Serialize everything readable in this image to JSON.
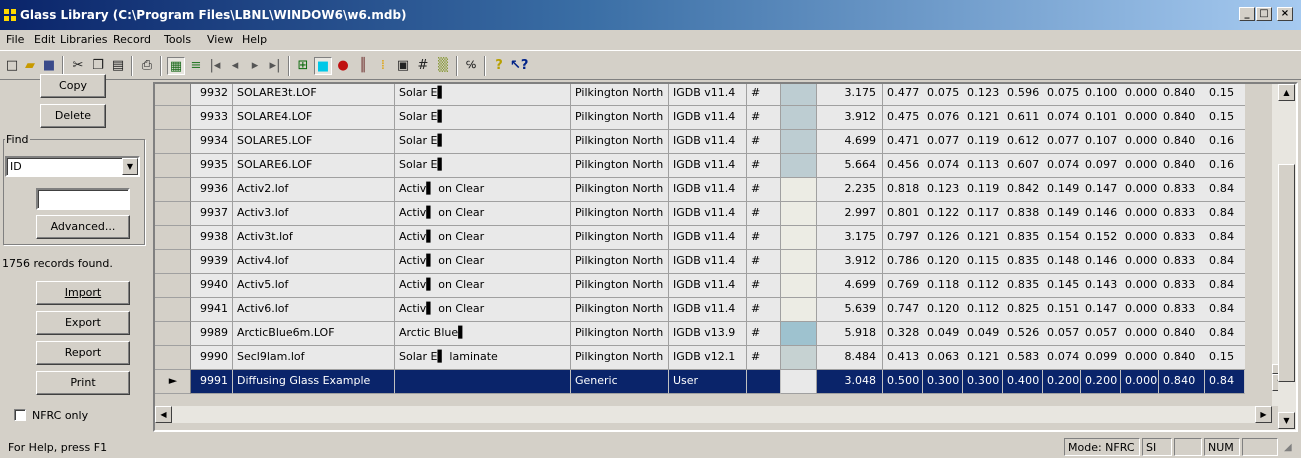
{
  "window": {
    "title": "Glass Library (C:\\Program Files\\LBNL\\WINDOW6\\w6.mdb)",
    "controls": {
      "minimize": "_",
      "maximize": "□",
      "close": "×"
    }
  },
  "menu": [
    "File",
    "Edit",
    "Libraries",
    "Record",
    "Tools",
    "View",
    "Help"
  ],
  "toolbar_icons": [
    "new-icon",
    "open-icon",
    "save-icon",
    "cut-icon",
    "copy-icon",
    "paste-icon",
    "print-icon",
    "grid-view-icon",
    "list-view-icon",
    "first-record-icon",
    "prev-record-icon",
    "next-record-icon",
    "last-record-icon",
    "layout-icon",
    "color-icon",
    "pin-icon",
    "bars-icon",
    "spectrum-icon",
    "square-icon",
    "hash-icon",
    "gradient-icon",
    "units-icon",
    "help-icon",
    "context-help-icon"
  ],
  "left": {
    "copy_label": "Copy",
    "delete_label": "Delete",
    "find_label": "Find",
    "find_field": "ID",
    "find_text": "",
    "advanced_label": "Advanced...",
    "records_found": "1756 records found.",
    "import_label": "Import",
    "export_label": "Export",
    "report_label": "Report",
    "print_label": "Print",
    "nfrc_label": "NFRC only"
  },
  "rows": [
    {
      "id": "9932",
      "name": "SOLARE3t.LOF",
      "product": "Solar E▌",
      "mfr": "Pilkington North",
      "source": "IGDB v11.4",
      "flag": "#",
      "color": "#bdcdd2",
      "thick": "3.175",
      "v": [
        "0.477",
        "0.075",
        "0.123",
        "0.596",
        "0.075",
        "0.100",
        "0.000",
        "0.840",
        "0.15"
      ]
    },
    {
      "id": "9933",
      "name": "SOLARE4.LOF",
      "product": "Solar E▌",
      "mfr": "Pilkington North",
      "source": "IGDB v11.4",
      "flag": "#",
      "color": "#bdcdd2",
      "thick": "3.912",
      "v": [
        "0.475",
        "0.076",
        "0.121",
        "0.611",
        "0.074",
        "0.101",
        "0.000",
        "0.840",
        "0.15"
      ]
    },
    {
      "id": "9934",
      "name": "SOLARE5.LOF",
      "product": "Solar E▌",
      "mfr": "Pilkington North",
      "source": "IGDB v11.4",
      "flag": "#",
      "color": "#bdcdd2",
      "thick": "4.699",
      "v": [
        "0.471",
        "0.077",
        "0.119",
        "0.612",
        "0.077",
        "0.107",
        "0.000",
        "0.840",
        "0.16"
      ]
    },
    {
      "id": "9935",
      "name": "SOLARE6.LOF",
      "product": "Solar E▌",
      "mfr": "Pilkington North",
      "source": "IGDB v11.4",
      "flag": "#",
      "color": "#bdcdd2",
      "thick": "5.664",
      "v": [
        "0.456",
        "0.074",
        "0.113",
        "0.607",
        "0.074",
        "0.097",
        "0.000",
        "0.840",
        "0.16"
      ]
    },
    {
      "id": "9936",
      "name": "Activ2.lof",
      "product": "Activ▌ on Clear",
      "mfr": "Pilkington North",
      "source": "IGDB v11.4",
      "flag": "#",
      "color": "#ecece4",
      "thick": "2.235",
      "v": [
        "0.818",
        "0.123",
        "0.119",
        "0.842",
        "0.149",
        "0.147",
        "0.000",
        "0.833",
        "0.84"
      ]
    },
    {
      "id": "9937",
      "name": "Activ3.lof",
      "product": "Activ▌ on Clear",
      "mfr": "Pilkington North",
      "source": "IGDB v11.4",
      "flag": "#",
      "color": "#ecece4",
      "thick": "2.997",
      "v": [
        "0.801",
        "0.122",
        "0.117",
        "0.838",
        "0.149",
        "0.146",
        "0.000",
        "0.833",
        "0.84"
      ]
    },
    {
      "id": "9938",
      "name": "Activ3t.lof",
      "product": "Activ▌ on Clear",
      "mfr": "Pilkington North",
      "source": "IGDB v11.4",
      "flag": "#",
      "color": "#ecece4",
      "thick": "3.175",
      "v": [
        "0.797",
        "0.126",
        "0.121",
        "0.835",
        "0.154",
        "0.152",
        "0.000",
        "0.833",
        "0.84"
      ]
    },
    {
      "id": "9939",
      "name": "Activ4.lof",
      "product": "Activ▌ on Clear",
      "mfr": "Pilkington North",
      "source": "IGDB v11.4",
      "flag": "#",
      "color": "#ecece4",
      "thick": "3.912",
      "v": [
        "0.786",
        "0.120",
        "0.115",
        "0.835",
        "0.148",
        "0.146",
        "0.000",
        "0.833",
        "0.84"
      ]
    },
    {
      "id": "9940",
      "name": "Activ5.lof",
      "product": "Activ▌ on Clear",
      "mfr": "Pilkington North",
      "source": "IGDB v11.4",
      "flag": "#",
      "color": "#ecece4",
      "thick": "4.699",
      "v": [
        "0.769",
        "0.118",
        "0.112",
        "0.835",
        "0.145",
        "0.143",
        "0.000",
        "0.833",
        "0.84"
      ]
    },
    {
      "id": "9941",
      "name": "Activ6.lof",
      "product": "Activ▌ on Clear",
      "mfr": "Pilkington North",
      "source": "IGDB v11.4",
      "flag": "#",
      "color": "#ecece4",
      "thick": "5.639",
      "v": [
        "0.747",
        "0.120",
        "0.112",
        "0.825",
        "0.151",
        "0.147",
        "0.000",
        "0.833",
        "0.84"
      ]
    },
    {
      "id": "9989",
      "name": "ArcticBlue6m.LOF",
      "product": "Arctic Blue▌",
      "mfr": "Pilkington North",
      "source": "IGDB v13.9",
      "flag": "#",
      "color": "#9ec2cf",
      "thick": "5.918",
      "v": [
        "0.328",
        "0.049",
        "0.049",
        "0.526",
        "0.057",
        "0.057",
        "0.000",
        "0.840",
        "0.84"
      ]
    },
    {
      "id": "9990",
      "name": "Secl9lam.lof",
      "product": "Solar E▌ laminate",
      "mfr": "Pilkington North",
      "source": "IGDB v12.1",
      "flag": "#",
      "color": "#c6d2d2",
      "thick": "8.484",
      "v": [
        "0.413",
        "0.063",
        "0.121",
        "0.583",
        "0.074",
        "0.099",
        "0.000",
        "0.840",
        "0.15"
      ]
    },
    {
      "id": "9991",
      "name": "Diffusing Glass Example",
      "product": "",
      "mfr": "Generic",
      "source": "User",
      "flag": "",
      "color": "#e9e9e9",
      "thick": "3.048",
      "v": [
        "0.500",
        "0.300",
        "0.300",
        "0.400",
        "0.200",
        "0.200",
        "0.000",
        "0.840",
        "0.84"
      ],
      "selected": true,
      "marker": "►"
    }
  ],
  "status": {
    "help": "For Help, press F1",
    "mode": "Mode: NFRC",
    "units": "SI",
    "num": "NUM"
  }
}
